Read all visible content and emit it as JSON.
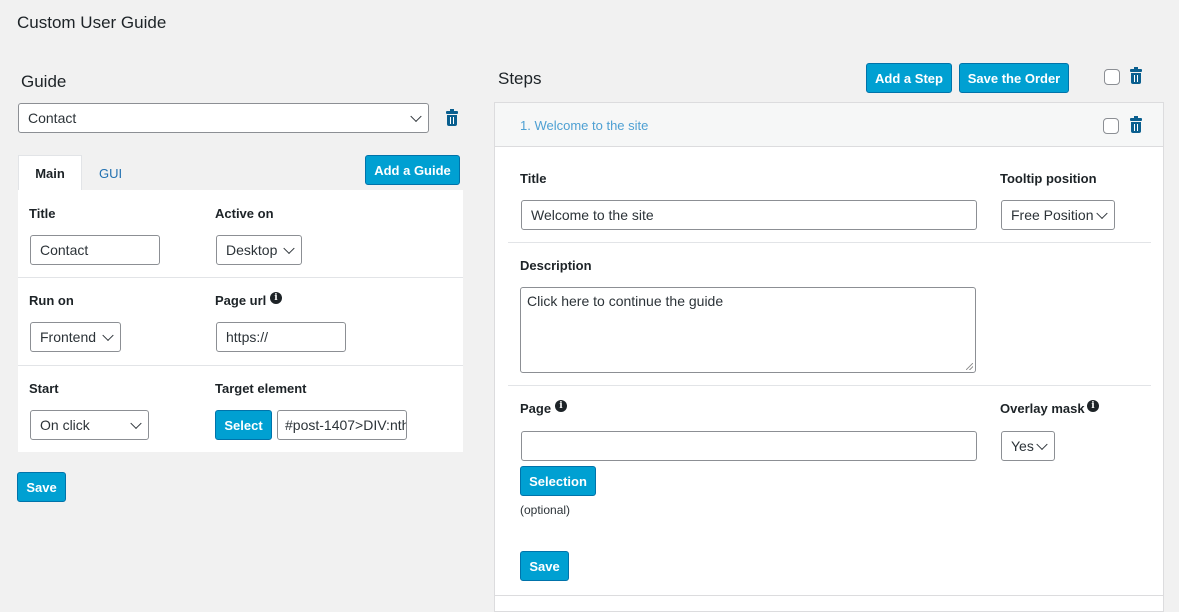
{
  "page": {
    "title": "Custom User Guide"
  },
  "guide": {
    "heading": "Guide",
    "selected": "Contact",
    "tabs": [
      {
        "label": "Main"
      },
      {
        "label": "GUI"
      }
    ],
    "add_button": "Add a Guide",
    "fields": {
      "title_label": "Title",
      "title_value": "Contact",
      "active_on_label": "Active on",
      "active_on_value": "Desktop",
      "run_on_label": "Run on",
      "run_on_value": "Frontend",
      "page_url_label": "Page url",
      "page_url_value": "https://",
      "start_label": "Start",
      "start_value": "On click",
      "target_label": "Target element",
      "select_button": "Select",
      "target_value": "#post-1407>DIV:nth"
    },
    "save_button": "Save"
  },
  "steps": {
    "heading": "Steps",
    "add_button": "Add a Step",
    "save_order_button": "Save the Order",
    "items": [
      {
        "header": "1. Welcome to the site",
        "title_label": "Title",
        "title_value": "Welcome to the site",
        "tooltip_label": "Tooltip position",
        "tooltip_value": "Free Position",
        "description_label": "Description",
        "description_value": "Click here to continue the guide",
        "page_label": "Page",
        "page_value": "",
        "selection_button": "Selection",
        "optional_text": "(optional)",
        "overlay_label": "Overlay mask",
        "overlay_value": "Yes",
        "save_button": "Save"
      }
    ]
  },
  "icons": {
    "trash": "trash-icon",
    "info": "info-icon",
    "chevron": "chevron-down-icon"
  },
  "colors": {
    "accent": "#00a0d2",
    "link": "#2271b1",
    "trash": "#0a5f8f",
    "background": "#f1f1f1"
  }
}
